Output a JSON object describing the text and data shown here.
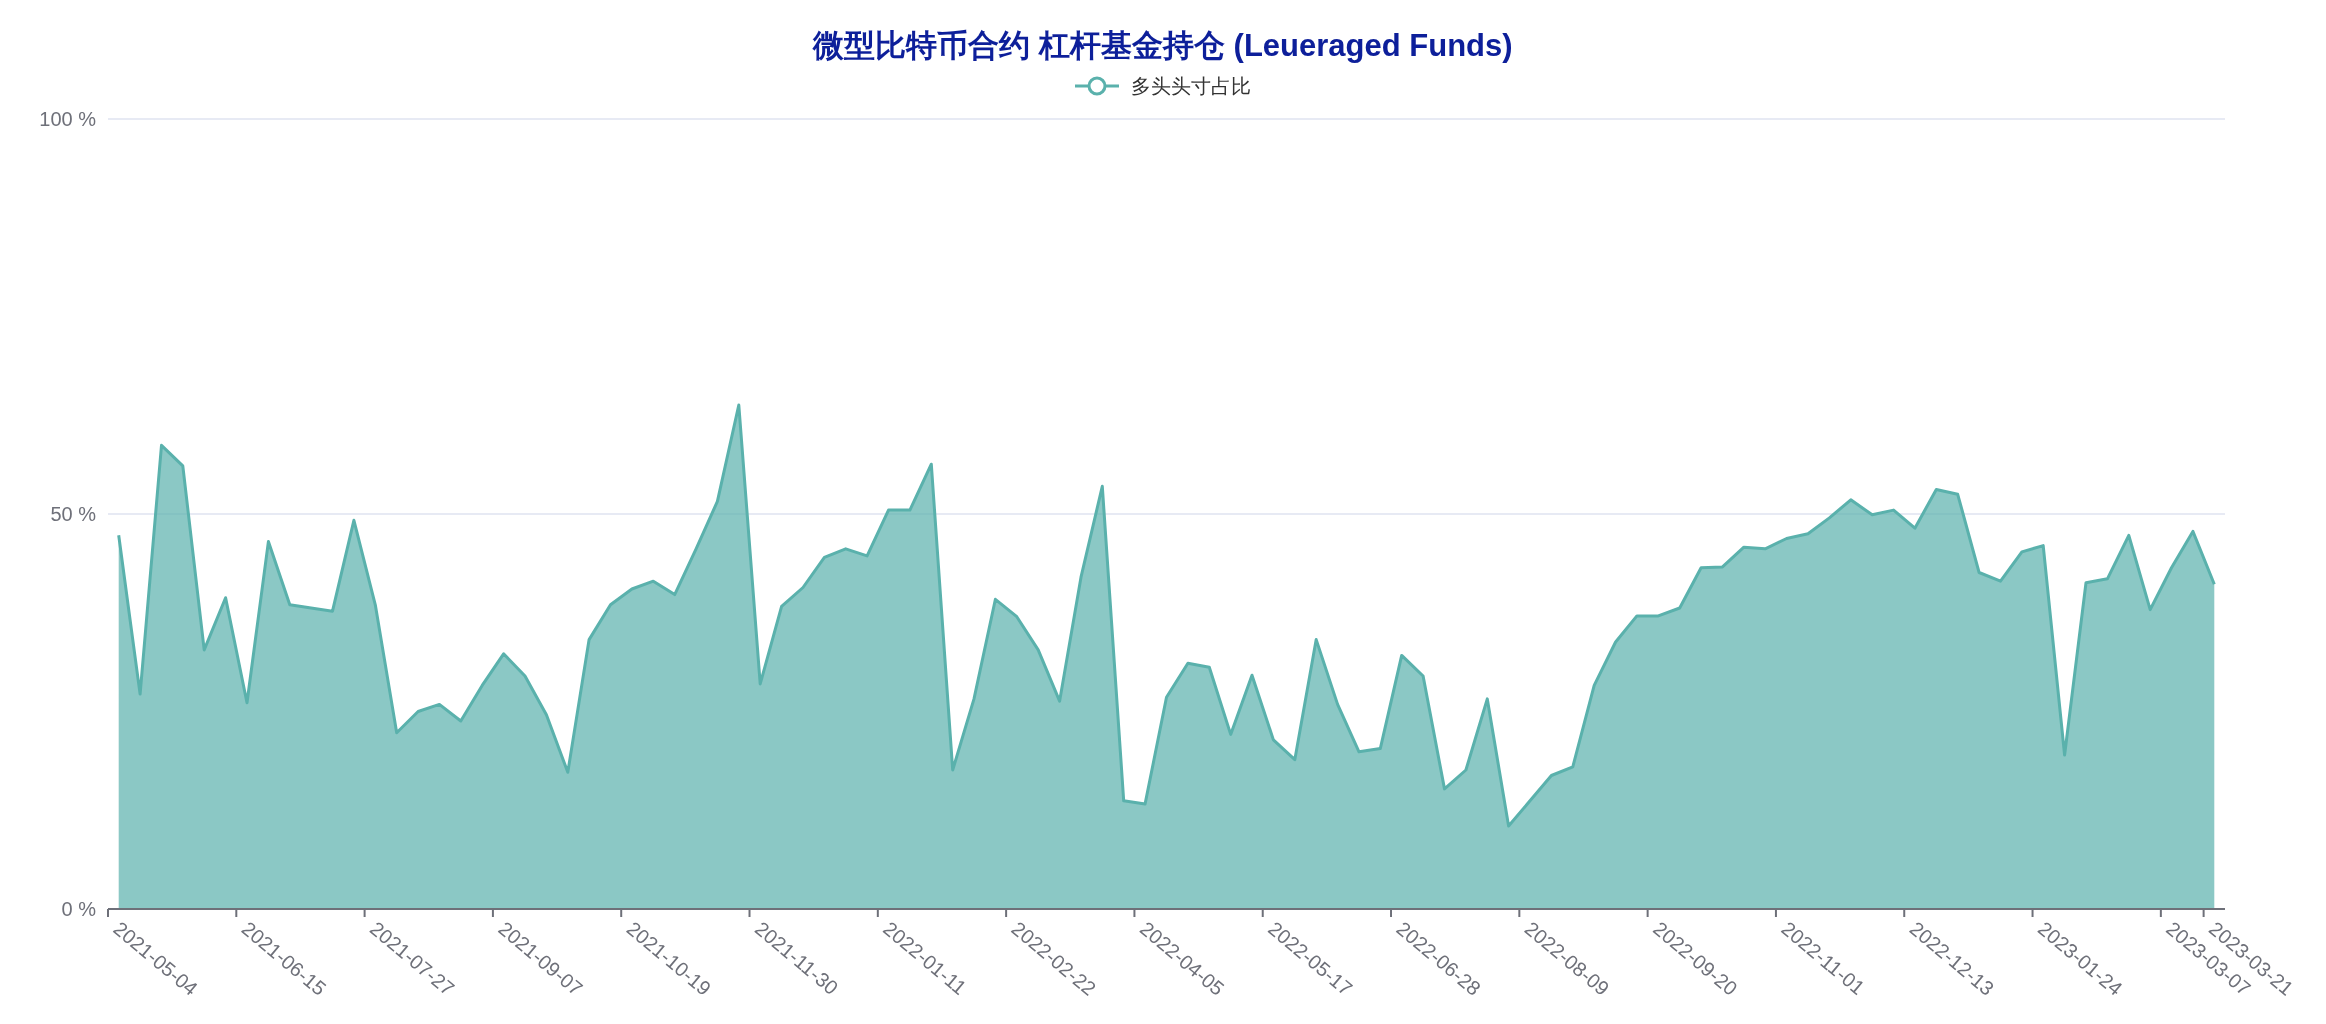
{
  "title": "微型比特币合约 杠杆基金持仓 (Leueraged Funds)",
  "chart_data": {
    "type": "area",
    "ylim": [
      0,
      100
    ],
    "yticks": [
      {
        "value": 0,
        "label": "0 %"
      },
      {
        "value": 50,
        "label": "50 %"
      },
      {
        "value": 100,
        "label": "100 %"
      }
    ],
    "categories": [
      "2021-05-04",
      null,
      null,
      null,
      null,
      null,
      "2021-06-15",
      null,
      null,
      null,
      null,
      null,
      "2021-07-27",
      null,
      null,
      null,
      null,
      null,
      "2021-09-07",
      null,
      null,
      null,
      null,
      null,
      "2021-10-19",
      null,
      null,
      null,
      null,
      null,
      "2021-11-30",
      null,
      null,
      null,
      null,
      null,
      "2022-01-11",
      null,
      null,
      null,
      null,
      null,
      "2022-02-22",
      null,
      null,
      null,
      null,
      null,
      "2022-04-05",
      null,
      null,
      null,
      null,
      null,
      "2022-05-17",
      null,
      null,
      null,
      null,
      null,
      "2022-06-28",
      null,
      null,
      null,
      null,
      null,
      "2022-08-09",
      null,
      null,
      null,
      null,
      null,
      "2022-09-20",
      null,
      null,
      null,
      null,
      null,
      "2022-11-01",
      null,
      null,
      null,
      null,
      null,
      "2022-12-13",
      null,
      null,
      null,
      null,
      null,
      "2023-01-24",
      null,
      null,
      null,
      null,
      null,
      "2023-03-07",
      null,
      "2023-03-21"
    ],
    "series": [
      {
        "name": "多头头寸占比",
        "color": "#5ab1ac",
        "values": [
          47.3,
          27.2,
          58.7,
          56.1,
          32.8,
          39.4,
          26.1,
          46.5,
          38.5,
          38.1,
          37.7,
          49.2,
          38.5,
          22.3,
          25.0,
          25.9,
          23.8,
          28.3,
          32.3,
          29.5,
          24.6,
          17.3,
          34.1,
          38.5,
          40.5,
          41.5,
          39.8,
          45.6,
          51.6,
          63.8,
          28.5,
          38.3,
          40.7,
          44.5,
          45.6,
          44.7,
          50.5,
          50.5,
          56.3,
          17.6,
          26.6,
          39.2,
          37.0,
          32.8,
          26.3,
          42.0,
          53.5,
          13.7,
          13.3,
          26.8,
          31.1,
          30.6,
          22.1,
          29.6,
          21.4,
          18.9,
          34.1,
          25.9,
          19.9,
          20.3,
          32.1,
          29.5,
          15.2,
          17.6,
          26.6,
          10.5,
          13.7,
          16.9,
          18.0,
          28.3,
          33.8,
          37.1,
          37.1,
          38.1,
          43.2,
          43.3,
          45.8,
          45.6,
          46.9,
          47.5,
          49.5,
          51.8,
          49.9,
          50.5,
          48.2,
          53.1,
          52.5,
          42.6,
          41.5,
          45.2,
          46.0,
          19.5,
          41.3,
          41.8,
          47.3,
          37.9,
          43.2,
          47.8,
          41.1
        ]
      }
    ]
  }
}
